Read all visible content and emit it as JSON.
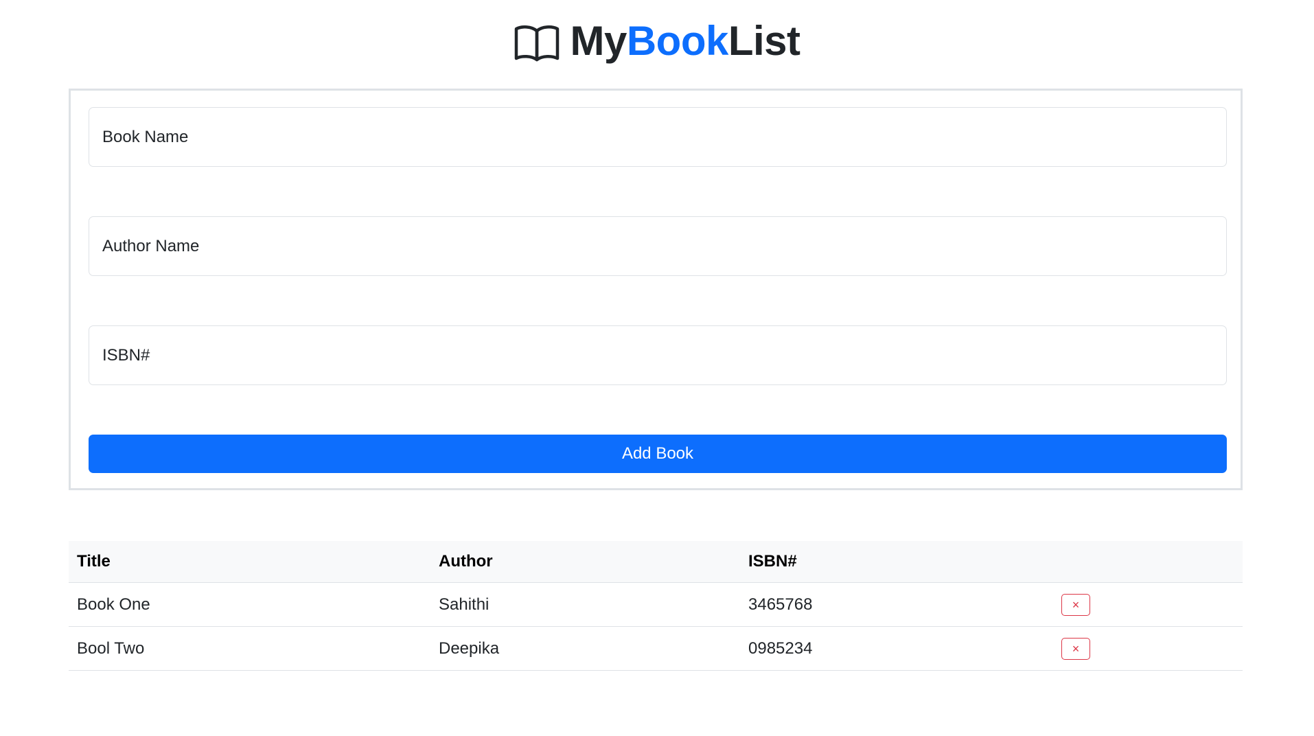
{
  "header": {
    "icon": "book-open-icon",
    "title_part1": "My",
    "title_part2": "Book",
    "title_part3": "List",
    "accent_color": "#0d6efd"
  },
  "form": {
    "book_name_placeholder": "Book Name",
    "author_name_placeholder": "Author Name",
    "isbn_placeholder": "ISBN#",
    "submit_label": "Add Book",
    "button_color": "#0d6efd"
  },
  "table": {
    "columns": [
      "Title",
      "Author",
      "ISBN#",
      ""
    ],
    "rows": [
      {
        "title": "Book One",
        "author": "Sahithi",
        "isbn": "3465768",
        "delete_icon": "close-icon",
        "delete_label": "×"
      },
      {
        "title": "Bool Two",
        "author": "Deepika",
        "isbn": "0985234",
        "delete_icon": "close-icon",
        "delete_label": "×"
      }
    ],
    "delete_color": "#dc3545"
  }
}
